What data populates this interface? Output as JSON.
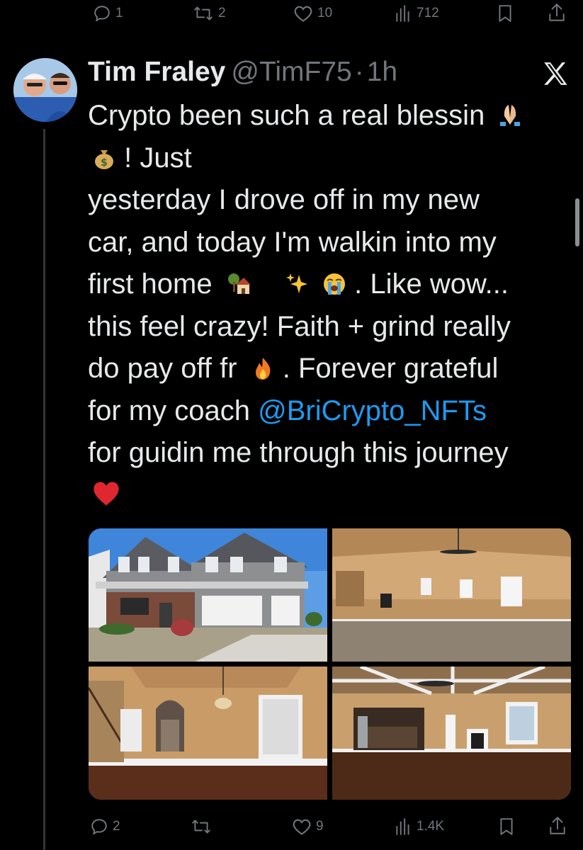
{
  "previous_tweet_actions": {
    "replies": "1",
    "reposts": "2",
    "likes": "10",
    "views": "712"
  },
  "tweet": {
    "author_name": "Tim Fraley",
    "author_handle": "@TimF75",
    "separator": "·",
    "time": "1h",
    "text_lines": [
      "Crypto been such a real blessin",
      "! Just",
      "yesterday I drove off in my new",
      "car, and today I'm walkin into my",
      "first home",
      ". Like wow...",
      "this feel crazy! Faith + grind really",
      "do pay off fr",
      ". Forever grateful",
      "for my coach",
      "@BriCrypto_NFTs",
      "for guidin me through this journey"
    ],
    "emojis": [
      "folded-hands",
      "money-bag",
      "house-with-garden",
      "sparkles",
      "loudly-crying-face",
      "fire",
      "red-heart"
    ],
    "photos": [
      "house-exterior-photo",
      "living-room-photo",
      "dining-room-photo",
      "kitchen-living-photo"
    ]
  },
  "tweet_actions": {
    "replies": "2",
    "reposts": "",
    "likes": "9",
    "views": "1.4K"
  },
  "colors": {
    "background": "#000000",
    "text": "#e7e9ea",
    "muted": "#71767b",
    "link": "#1d9bf0"
  }
}
